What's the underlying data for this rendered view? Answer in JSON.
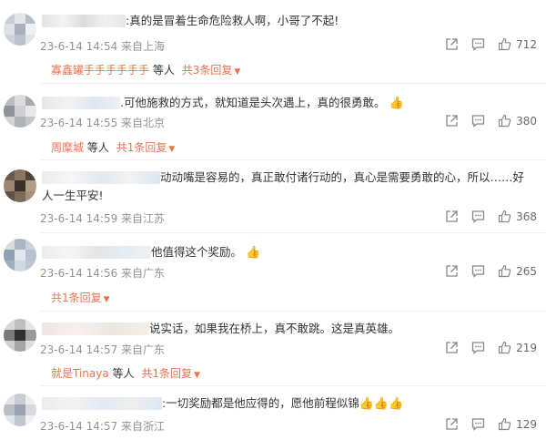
{
  "comments": [
    {
      "text": ":真的是冒着生命危险救人啊，小哥了不起!",
      "meta": "23-6-14 14:54 来自上海",
      "likes": "712",
      "reply": {
        "users": "寡鑫罐手手手手手手",
        "suffix": "等人",
        "more": "共3条回复"
      }
    },
    {
      "text": ".可他施救的方式，就知道是头次遇上，真的很勇敢。",
      "meta": "23-6-14 14:55 来自北京",
      "likes": "380",
      "reply": {
        "users": "周糜城",
        "suffix": "等人",
        "more": "共1条回复"
      }
    },
    {
      "text_line1": "动动嘴是容易的，真正敢付诸行动的，真心是需要勇敢的心，所以……好",
      "text_line2": "人一生平安!",
      "meta": "23-6-14 14:59 来自江苏",
      "likes": "368"
    },
    {
      "text": "他值得这个奖励。",
      "meta": "23-6-14 14:56 来自广东",
      "likes": "265",
      "reply": {
        "more": "共1条回复"
      }
    },
    {
      "text": "说实话，如果我在桥上，真不敢跳。这是真英雄。",
      "meta": "23-6-14 14:57 来自广东",
      "likes": "219",
      "reply": {
        "users": "就是Tinaya",
        "suffix": "等人",
        "more": "共1条回复"
      }
    },
    {
      "text": ":一切奖励都是他应得的，愿他前程似锦",
      "meta": "23-6-14 14:57 来自浙江",
      "likes": "129"
    }
  ],
  "colors": {
    "link": "#eb7350",
    "meta": "#939393",
    "icon": "#888888"
  }
}
